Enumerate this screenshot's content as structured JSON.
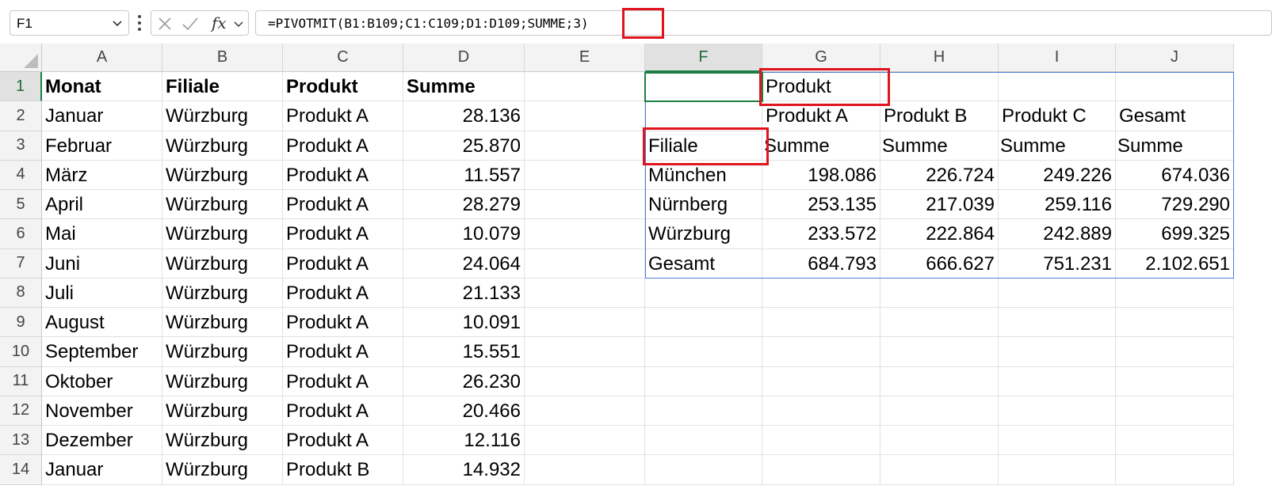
{
  "name_box": {
    "value": "F1"
  },
  "formula_bar": {
    "formula": "=PIVOTMIT(B1:B109;C1:C109;D1:D109;SUMME;3)",
    "cancel_icon": "cancel-icon",
    "enter_icon": "check-icon",
    "fx_label": "fx"
  },
  "columns": [
    "A",
    "B",
    "C",
    "D",
    "E",
    "F",
    "G",
    "H",
    "I",
    "J"
  ],
  "active_column": "F",
  "rows": [
    "1",
    "2",
    "3",
    "4",
    "5",
    "6",
    "7",
    "8",
    "9",
    "10",
    "11",
    "12",
    "13",
    "14"
  ],
  "active_row": "1",
  "source_table": {
    "headers": [
      "Monat",
      "Filiale",
      "Produkt",
      "Summe"
    ],
    "rows": [
      [
        "Januar",
        "Würzburg",
        "Produkt A",
        "28.136"
      ],
      [
        "Februar",
        "Würzburg",
        "Produkt A",
        "25.870"
      ],
      [
        "März",
        "Würzburg",
        "Produkt A",
        "11.557"
      ],
      [
        "April",
        "Würzburg",
        "Produkt A",
        "28.279"
      ],
      [
        "Mai",
        "Würzburg",
        "Produkt A",
        "10.079"
      ],
      [
        "Juni",
        "Würzburg",
        "Produkt A",
        "24.064"
      ],
      [
        "Juli",
        "Würzburg",
        "Produkt A",
        "21.133"
      ],
      [
        "August",
        "Würzburg",
        "Produkt A",
        "10.091"
      ],
      [
        "September",
        "Würzburg",
        "Produkt A",
        "15.551"
      ],
      [
        "Oktober",
        "Würzburg",
        "Produkt A",
        "26.230"
      ],
      [
        "November",
        "Würzburg",
        "Produkt A",
        "20.466"
      ],
      [
        "Dezember",
        "Würzburg",
        "Produkt A",
        "12.116"
      ],
      [
        "Januar",
        "Würzburg",
        "Produkt B",
        "14.932"
      ]
    ]
  },
  "pivot": {
    "col_field": "Produkt",
    "row_field": "Filiale",
    "col_headers": [
      "Produkt A",
      "Produkt B",
      "Produkt C",
      "Gesamt"
    ],
    "measure_labels": [
      "Summe",
      "Summe",
      "Summe",
      "Summe"
    ],
    "rows": [
      {
        "label": "München",
        "values": [
          "198.086",
          "226.724",
          "249.226",
          "674.036"
        ]
      },
      {
        "label": "Nürnberg",
        "values": [
          "253.135",
          "217.039",
          "259.116",
          "729.290"
        ]
      },
      {
        "label": "Würzburg",
        "values": [
          "233.572",
          "222.864",
          "242.889",
          "699.325"
        ]
      },
      {
        "label": "Gesamt",
        "values": [
          "684.793",
          "666.627",
          "751.231",
          "2.102.651"
        ]
      }
    ]
  },
  "colors": {
    "highlight": "#e0141e",
    "selection": "#1e7e45",
    "spill": "#4a7fd4"
  }
}
